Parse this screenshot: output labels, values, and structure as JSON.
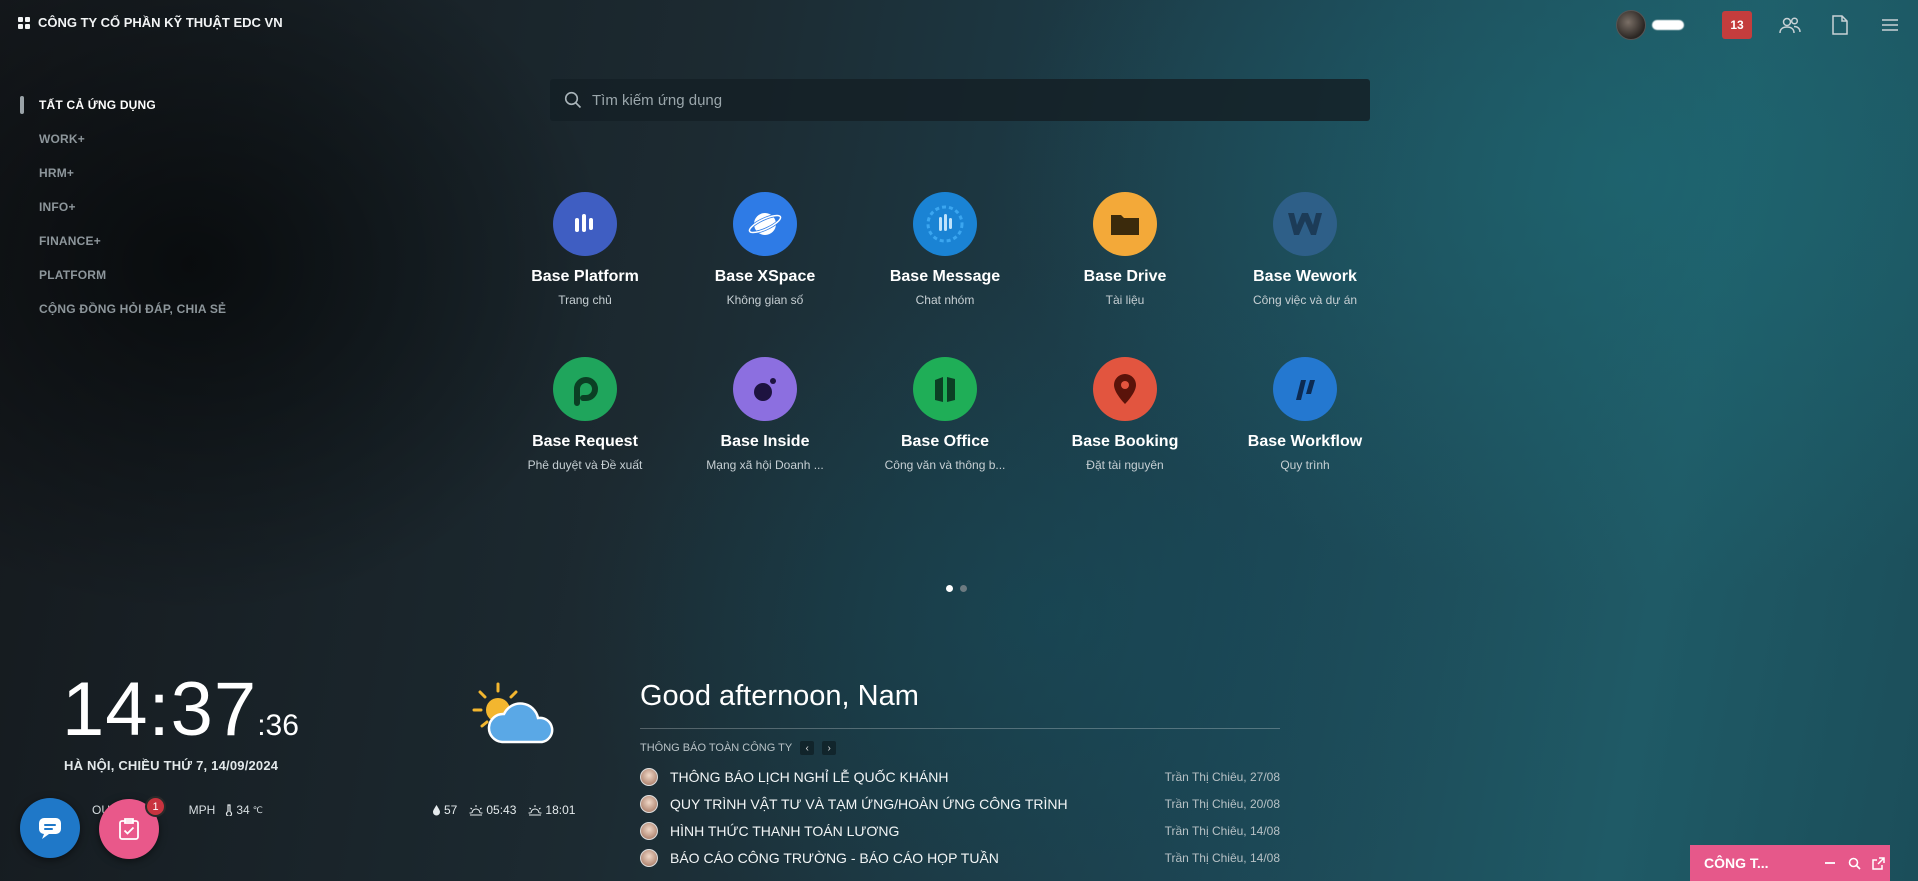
{
  "header": {
    "company": "CÔNG TY CỔ PHẦN KỸ THUẬT EDC VN",
    "notification_count": "13"
  },
  "sidebar": {
    "items": [
      {
        "label": "TẤT CẢ ỨNG DỤNG",
        "active": true
      },
      {
        "label": "WORK+"
      },
      {
        "label": "HRM+"
      },
      {
        "label": "INFO+"
      },
      {
        "label": "FINANCE+"
      },
      {
        "label": "PLATFORM"
      },
      {
        "label": "CỘNG ĐỒNG HỎI ĐÁP, CHIA SẺ"
      }
    ]
  },
  "search": {
    "placeholder": "Tìm kiếm ứng dụng"
  },
  "apps": [
    {
      "name": "Base Platform",
      "sub": "Trang chủ",
      "color": "#3f5ec2"
    },
    {
      "name": "Base XSpace",
      "sub": "Không gian số",
      "color": "#2e7be6"
    },
    {
      "name": "Base Message",
      "sub": "Chat nhóm",
      "color": "#1a83d4"
    },
    {
      "name": "Base Drive",
      "sub": "Tài liệu",
      "color": "#f3a939"
    },
    {
      "name": "Base Wework",
      "sub": "Công việc và dự án",
      "color": "#2e5f88"
    },
    {
      "name": "Base Request",
      "sub": "Phê duyệt và Đề xuất",
      "color": "#1fa55c"
    },
    {
      "name": "Base Inside",
      "sub": "Mạng xã hội Doanh ...",
      "color": "#8c6fe0"
    },
    {
      "name": "Base Office",
      "sub": "Công văn và thông b...",
      "color": "#1fae57"
    },
    {
      "name": "Base Booking",
      "sub": "Đặt tài nguyên",
      "color": "#e2553f"
    },
    {
      "name": "Base Workflow",
      "sub": "Quy trình",
      "color": "#2478d0"
    }
  ],
  "clock": {
    "time": "14:37",
    "seconds": ":36",
    "date": "HÀ NỘI, CHIỀU THỨ 7, 14/09/2024"
  },
  "weather": {
    "condition_partial": "OUDS",
    "wind_partial": "MPH",
    "temperature": "34",
    "temp_unit": "℃",
    "humidity": "57",
    "sunrise": "05:43",
    "sunset": "18:01"
  },
  "greeting": "Good afternoon, Nam",
  "announcements": {
    "heading": "THÔNG BÁO TOÀN CÔNG TY",
    "items": [
      {
        "title": "THÔNG BÁO LỊCH NGHỈ LỄ QUỐC KHÁNH",
        "meta": "Trần Thị Chiêu, 27/08"
      },
      {
        "title": "QUY TRÌNH VẬT TƯ VÀ TẠM ỨNG/HOÀN ỨNG CÔNG TRÌNH",
        "meta": "Trần Thị Chiêu, 20/08"
      },
      {
        "title": "HÌNH THỨC THANH TOÁN LƯƠNG",
        "meta": "Trần Thị Chiêu, 14/08"
      },
      {
        "title": "BÁO CÁO CÔNG TRƯỜNG - BÁO CÁO HỌP TUẦN",
        "meta": "Trần Thị Chiêu, 14/08"
      }
    ]
  },
  "task_badge": "1",
  "chat_window": {
    "title": "CÔNG T..."
  }
}
